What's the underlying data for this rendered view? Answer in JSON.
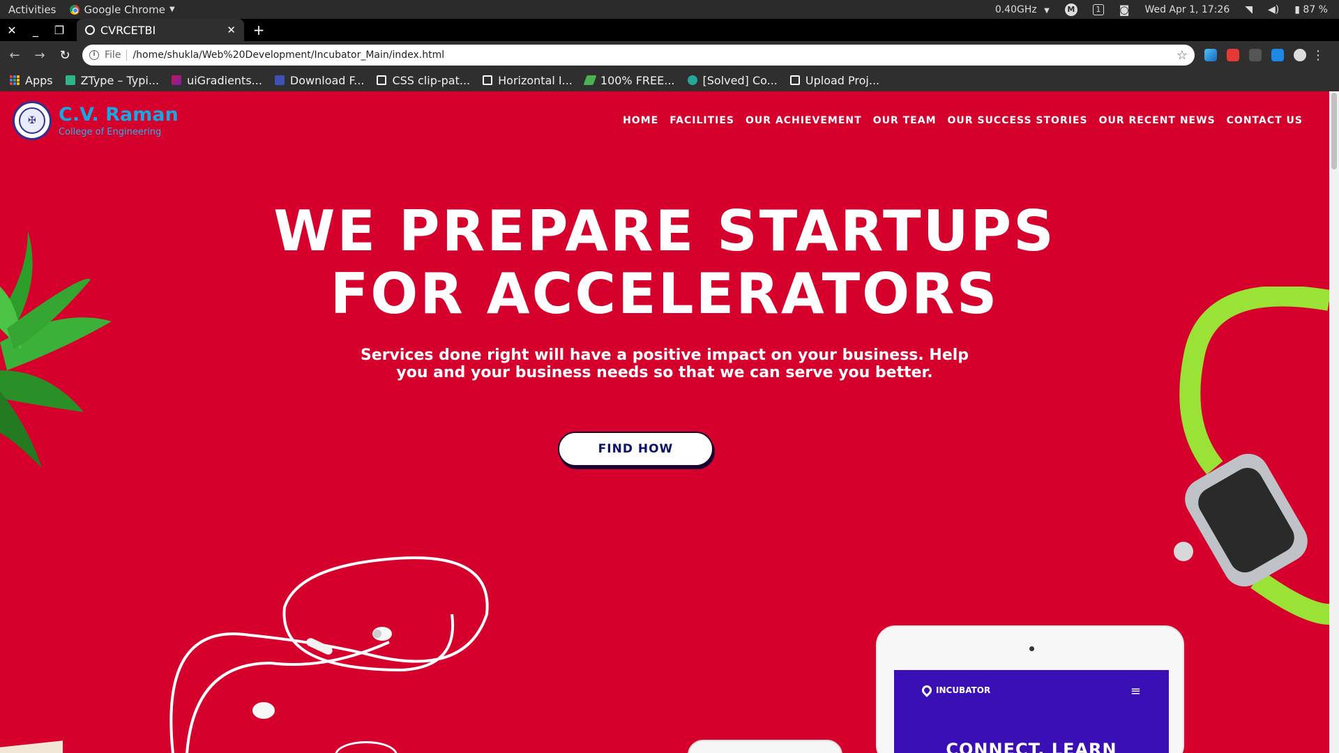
{
  "os": {
    "activities": "Activities",
    "app_name": "Google Chrome",
    "cpu": "0.40GHz",
    "workspace": "1",
    "datetime": "Wed Apr  1, 17:26",
    "battery": "87 %"
  },
  "browser": {
    "tab_title": "CVRCETBI",
    "file_label": "File",
    "url": "/home/shukla/Web%20Development/Incubator_Main/index.html",
    "bookmarks": [
      {
        "label": "Apps",
        "color": "#e94235"
      },
      {
        "label": "ZType – Typi...",
        "color": "#2fb38a"
      },
      {
        "label": "uiGradients...",
        "color": "#c2185b"
      },
      {
        "label": "Download F...",
        "color": "#3f51b5"
      },
      {
        "label": "CSS clip-pat...",
        "color": "#ffffff"
      },
      {
        "label": "Horizontal I...",
        "color": "#ffffff"
      },
      {
        "label": "100% FREE...",
        "color": "#4caf50"
      },
      {
        "label": "[Solved] Co...",
        "color": "#26a69a"
      },
      {
        "label": "Upload Proj...",
        "color": "#ffffff"
      }
    ]
  },
  "site": {
    "brand_name": "C.V. Raman",
    "brand_sub": "College of Engineering",
    "nav": [
      "HOME",
      "FACILITIES",
      "OUR ACHIEVEMENT",
      "OUR TEAM",
      "OUR SUCCESS STORIES",
      "OUR RECENT NEWS",
      "CONTACT US"
    ],
    "hero_title_line1": "WE PREPARE STARTUPS",
    "hero_title_line2": "FOR ACCELERATORS",
    "hero_subtitle": "Services done right will have a positive impact on your business. Help you and your business needs so that we can serve you better.",
    "cta_label": "FIND HOW",
    "tablet_brand": "INCUBATOR",
    "tablet_heading": "CONNECT. LEARN",
    "colors": {
      "hero_bg": "#d5002c",
      "brand_blue": "#1aa7e0",
      "cta_text": "#0c1268"
    }
  }
}
